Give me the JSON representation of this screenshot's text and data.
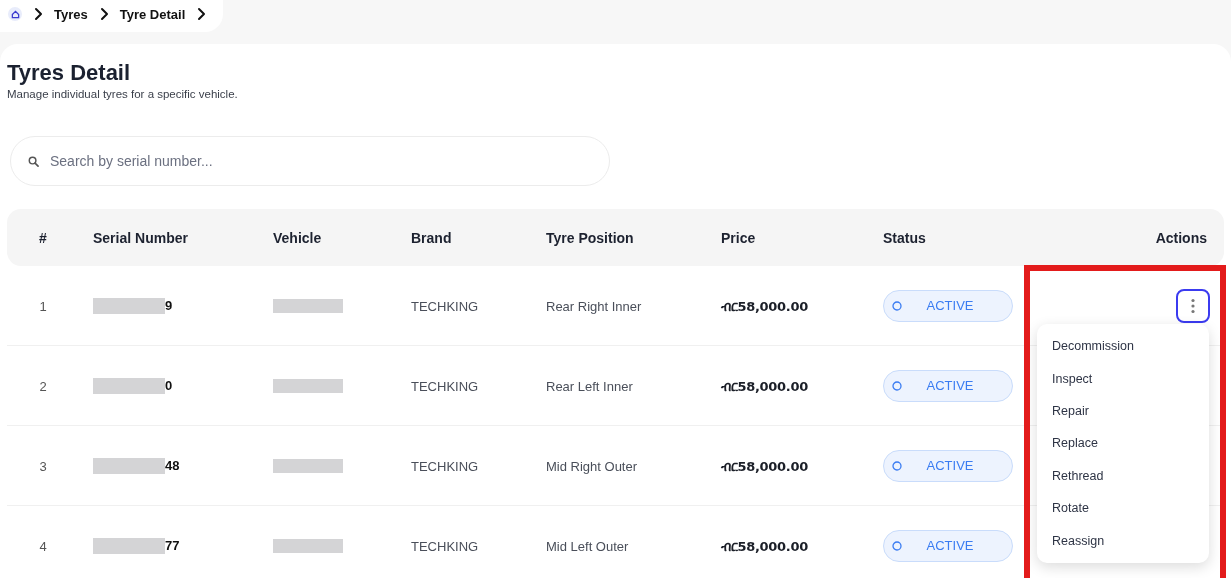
{
  "breadcrumb": [
    "Tyres",
    "Tyre Detail"
  ],
  "page": {
    "title": "Tyres Detail",
    "subtitle": "Manage individual tyres for a specific vehicle."
  },
  "search": {
    "placeholder": "Search by serial number..."
  },
  "table": {
    "columns": [
      "#",
      "Serial Number",
      "Vehicle",
      "Brand",
      "Tyre Position",
      "Price",
      "Status",
      "Actions"
    ],
    "rows": [
      {
        "index": "1",
        "serial_visible": "9",
        "brand": "TECHKING",
        "position": "Rear Right Inner",
        "price": "ብር58,000.00",
        "status": "ACTIVE",
        "menu_open": true
      },
      {
        "index": "2",
        "serial_visible": "0",
        "brand": "TECHKING",
        "position": "Rear Left Inner",
        "price": "ብር58,000.00",
        "status": "ACTIVE",
        "menu_open": false
      },
      {
        "index": "3",
        "serial_visible": "48",
        "brand": "TECHKING",
        "position": "Mid Right Outer",
        "price": "ብር58,000.00",
        "status": "ACTIVE",
        "menu_open": false
      },
      {
        "index": "4",
        "serial_visible": "77",
        "brand": "TECHKING",
        "position": "Mid Left Outer",
        "price": "ብር58,000.00",
        "status": "ACTIVE",
        "menu_open": false
      }
    ]
  },
  "actions_menu": {
    "highlighted": true,
    "items": [
      "Decommission",
      "Inspect",
      "Repair",
      "Replace",
      "Rethread",
      "Rotate",
      "Reassign"
    ]
  }
}
